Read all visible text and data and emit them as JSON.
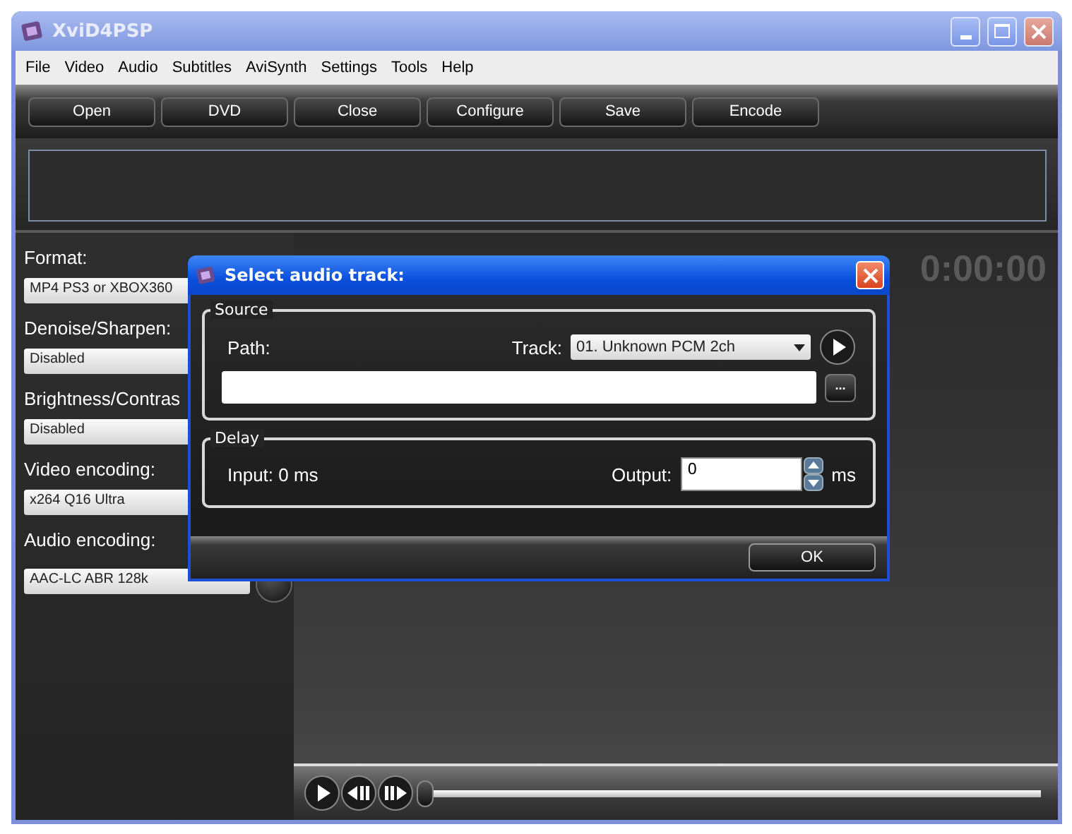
{
  "window": {
    "title": "XviD4PSP",
    "active": false
  },
  "menu": [
    "File",
    "Video",
    "Audio",
    "Subtitles",
    "AviSynth",
    "Settings",
    "Tools",
    "Help"
  ],
  "toolbar": [
    "Open",
    "DVD",
    "Close",
    "Configure",
    "Save",
    "Encode"
  ],
  "settings": [
    {
      "label": "Format:",
      "value": "MP4 PS3 or XBOX360"
    },
    {
      "label": "Denoise/Sharpen:",
      "value": "Disabled"
    },
    {
      "label": "Brightness/Contras",
      "value": "Disabled"
    },
    {
      "label": "Video encoding:",
      "value": "x264 Q16 Ultra"
    },
    {
      "label": "Audio encoding:",
      "value": "AAC-LC ABR 128k"
    }
  ],
  "timecode": "0:00:00",
  "player": {
    "position": {
      "level": 0
    }
  },
  "dialog": {
    "title": "Select audio track:",
    "source": {
      "legend": "Source",
      "path_label": "Path:",
      "track_label": "Track:",
      "track_value": "01. Unknown PCM 2ch",
      "browse": "..."
    },
    "delay": {
      "legend": "Delay",
      "input": "Input: 0 ms",
      "output_label": "Output:",
      "output_value": "0",
      "unit": "ms"
    },
    "ok": "OK"
  }
}
